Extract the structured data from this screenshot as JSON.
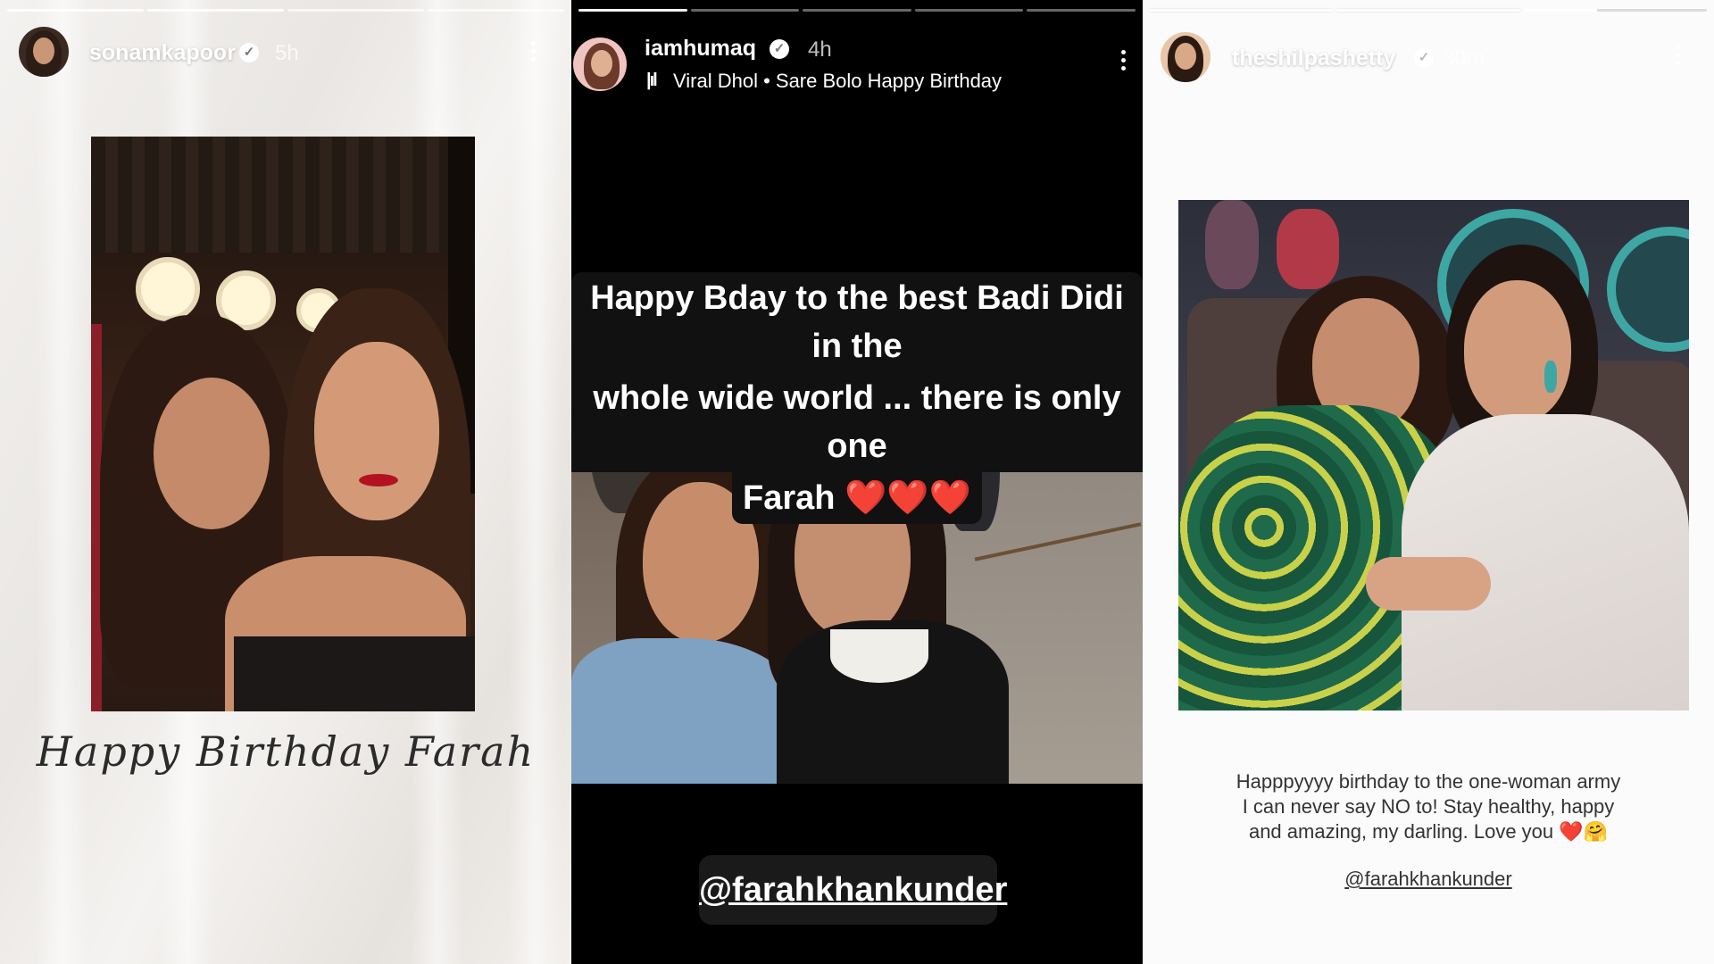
{
  "stories": [
    {
      "username": "sonamkapoor",
      "time": "5h",
      "caption": "Happy Birthday Farah"
    },
    {
      "username": "iamhumaq",
      "time": "4h",
      "music": "Viral Dhol • Sare Bolo Happy Birthday",
      "caption_lines": [
        "Happy Bday to the best Badi Didi in the",
        "whole wide world ... there is only one",
        "Farah ❤️❤️❤️"
      ],
      "mention": "@farahkhankunder"
    },
    {
      "username": "theshilpashetty",
      "time": "30m",
      "caption_lines": [
        "Happpyyyy birthday to the one-woman army",
        "I can never say NO to! Stay healthy, happy",
        "and amazing, my darling. Love you ❤️🤗"
      ],
      "mention": "@farahkhankunder"
    }
  ]
}
